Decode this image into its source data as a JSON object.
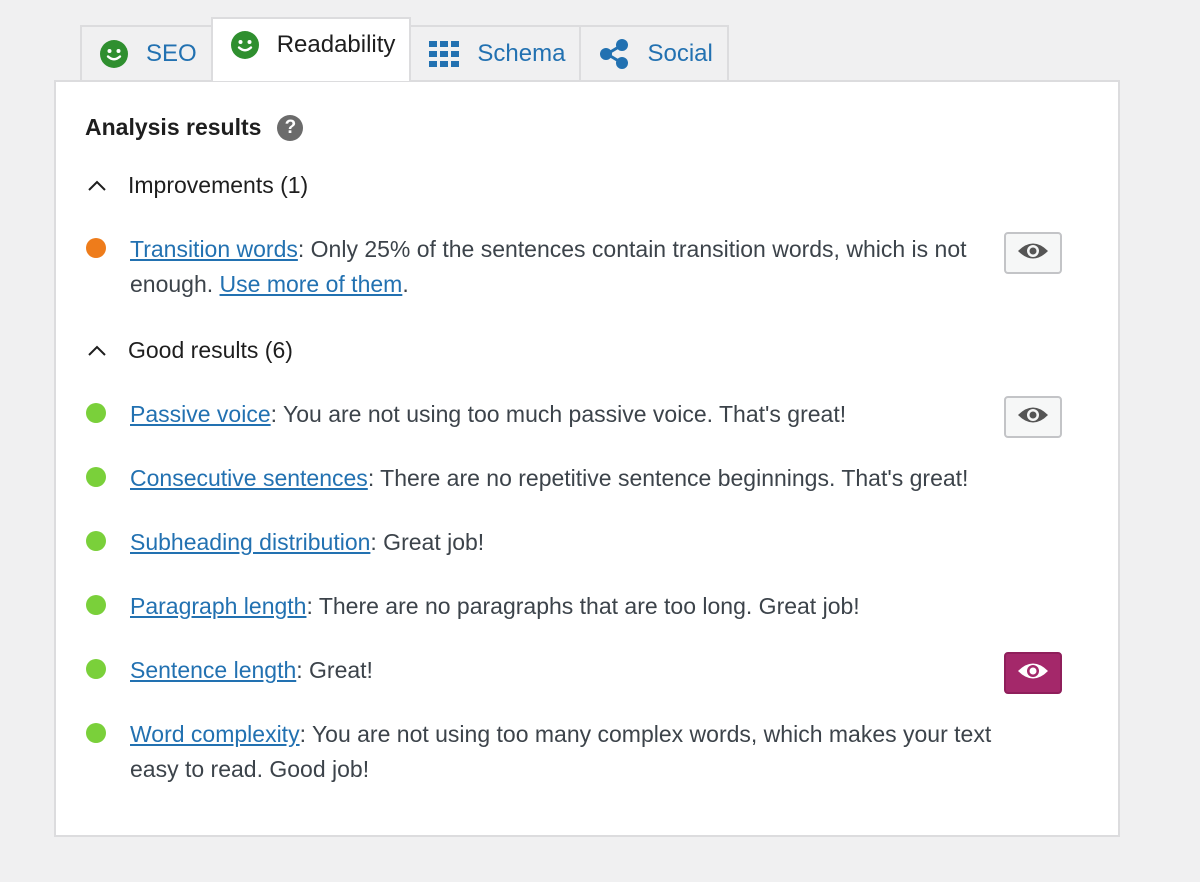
{
  "tabs": [
    {
      "label": "SEO",
      "icon": "smiley-icon",
      "active": false
    },
    {
      "label": "Readability",
      "icon": "smiley-icon",
      "active": true
    },
    {
      "label": "Schema",
      "icon": "grid-icon",
      "active": false
    },
    {
      "label": "Social",
      "icon": "share-icon",
      "active": false
    }
  ],
  "analysis": {
    "title": "Analysis results",
    "help_glyph": "?"
  },
  "improvements": {
    "header": "Improvements (1)",
    "items": [
      {
        "status": "orange",
        "link": "Transition words",
        "text": ": Only 25% of the sentences contain transition words, which is not enough. ",
        "link2": "Use more of them",
        "tail": "."
      }
    ]
  },
  "good": {
    "header": "Good results (6)",
    "items": [
      {
        "link": "Passive voice",
        "text": ": You are not using too much passive voice. That's great!"
      },
      {
        "link": "Consecutive sentences",
        "text": ": There are no repetitive sentence beginnings. That's great!"
      },
      {
        "link": "Subheading distribution",
        "text": ": Great job!"
      },
      {
        "link": "Paragraph length",
        "text": ": There are no paragraphs that are too long. Great job!"
      },
      {
        "link": "Sentence length",
        "text": ": Great!"
      },
      {
        "link": "Word complexity",
        "text": ": You are not using too many complex words, which makes your text easy to read. Good job!"
      }
    ]
  },
  "colors": {
    "good": "#7ad03a",
    "improve": "#ee7c1b",
    "smiley": "#2f8f2f",
    "link": "#2271b1",
    "eye_active": "#a4286a"
  }
}
